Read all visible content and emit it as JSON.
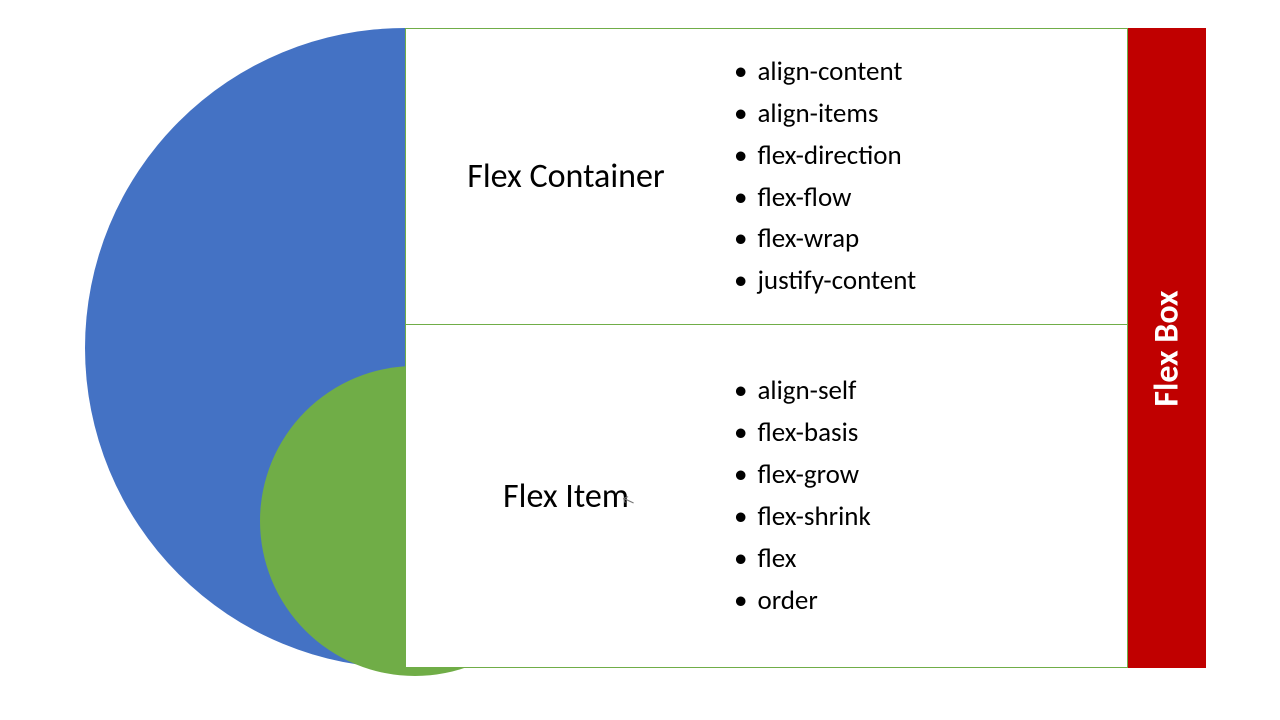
{
  "sidebar": {
    "label": "Flex Box"
  },
  "sections": {
    "container": {
      "title": "Flex Container",
      "props": [
        "align-content",
        "align-items",
        "flex-direction",
        "flex-flow",
        "flex-wrap",
        "justify-content"
      ]
    },
    "item": {
      "title": "Flex Item",
      "props": [
        "align-self",
        "flex-basis",
        "flex-grow",
        "flex-shrink",
        "flex",
        "order"
      ]
    }
  },
  "colors": {
    "blue": "#4472C4",
    "green": "#70AD47",
    "red": "#C00000"
  }
}
